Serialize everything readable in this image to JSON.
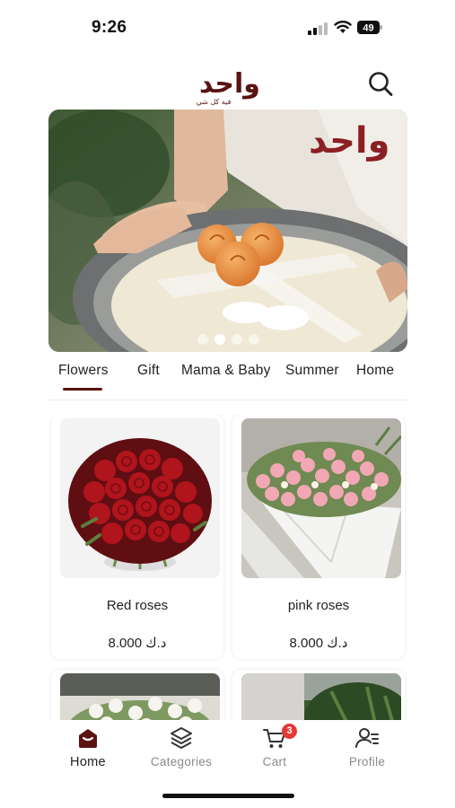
{
  "status_bar": {
    "time": "9:26",
    "battery_level": "49",
    "icons": [
      "signal-icon",
      "wifi-icon",
      "battery-icon"
    ]
  },
  "header": {
    "logo_text": "واحد",
    "logo_tagline": "فيه كل شي",
    "search_icon": "search-icon"
  },
  "hero": {
    "slide_count": 4,
    "active_slide": 1
  },
  "categories": [
    {
      "label": "Flowers",
      "active": true
    },
    {
      "label": "Gift",
      "active": false
    },
    {
      "label": "Mama & Baby",
      "active": false
    },
    {
      "label": "Summer",
      "active": false
    },
    {
      "label": "Home",
      "active": false
    }
  ],
  "products": [
    {
      "name": "Red roses",
      "price": "8.000 د.ك"
    },
    {
      "name": "pink roses",
      "price": "8.000 د.ك"
    }
  ],
  "bottom_nav": [
    {
      "label": "Home",
      "icon": "home-icon",
      "active": true
    },
    {
      "label": "Categories",
      "icon": "layers-icon",
      "active": false
    },
    {
      "label": "Cart",
      "icon": "cart-icon",
      "active": false,
      "badge": "3"
    },
    {
      "label": "Profile",
      "icon": "profile-icon",
      "active": false
    }
  ],
  "colors": {
    "brand": "#5a1212",
    "badge": "#e53935",
    "inactive": "#8a8a8a"
  }
}
